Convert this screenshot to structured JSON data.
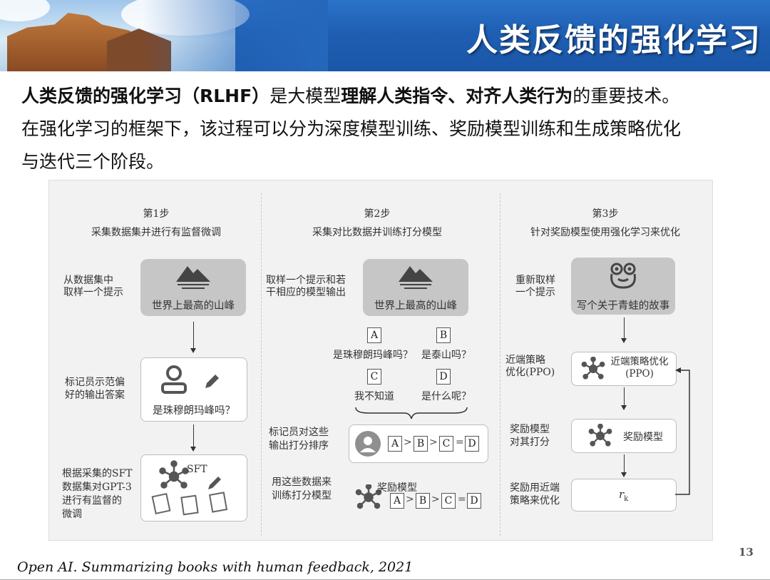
{
  "slide": {
    "title": "人类反馈的强化学习",
    "page_number": "13",
    "citation": "Open AI. Summarizing books with human feedback, 2021"
  },
  "intro": {
    "p1_bold": "人类反馈的强化学习（RLHF）",
    "p2": "是大模型",
    "p3_bold": "理解人类指令、对齐人类行为",
    "p4": "的重要技术。",
    "line2": "在强化学习的框架下，该过程可以分为深度模型训练、奖励模型训练和生成策略优化",
    "line3": "与迭代三个阶段。"
  },
  "figure": {
    "step1": {
      "title": "第1步",
      "subtitle": "采集数据集并进行有监督微调",
      "sample_label": "从数据集中\n取样一个提示",
      "prompt_text": "世界上最高的山峰",
      "annotator_label": "标记员示范偏\n好的输出答案",
      "answer_text": "是珠穆朗玛峰吗？",
      "finetune_label": "根据采集的SFT\n数据集对GPT-3\n进行有监督的\n微调",
      "sft_label": "SFT"
    },
    "step2": {
      "title": "第2步",
      "subtitle": "采集对比数据并训练打分模型",
      "sample_label": "取样一个提示和若\n干相应的模型输出",
      "prompt_text": "世界上最高的山峰",
      "options": [
        {
          "letter": "A",
          "text": "是珠穆朗玛峰吗？"
        },
        {
          "letter": "B",
          "text": "是泰山吗？"
        },
        {
          "letter": "C",
          "text": "我不知道"
        },
        {
          "letter": "D",
          "text": "是什么呢？"
        }
      ],
      "rank_label": "标记员对这些\n输出打分排序",
      "train_label": "用这些数据来\n训练打分模型",
      "reward_model": "奖励模型",
      "ranking": [
        "A",
        ">",
        "B",
        ">",
        "C",
        "=",
        "D"
      ]
    },
    "step3": {
      "title": "第3步",
      "subtitle": "针对奖励模型使用强化学习来优化",
      "resample_label": "重新取样\n一个提示",
      "prompt_text": "写个关于青蛙的故事",
      "ppo_label": "近端策略\n优化(PPO)",
      "ppo_box": "近端策略优化\n(PPO)",
      "reward_label": "奖励模型\n对其打分",
      "reward_box": "奖励模型",
      "update_label": "奖励用近端\n策略来优化",
      "rk": "r",
      "rk_sub": "k"
    }
  }
}
